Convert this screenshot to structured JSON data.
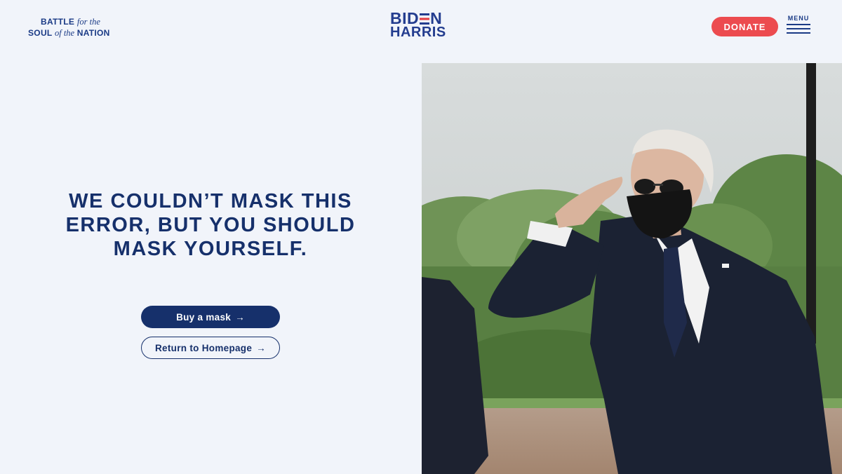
{
  "header": {
    "tagline": {
      "line1_bold": "BATTLE",
      "line1_italic": "for the",
      "line2_bold_a": "SOUL",
      "line2_italic": "of the",
      "line2_bold_b": "NATION"
    },
    "logo": {
      "line1_start": "BID",
      "line1_end": "N",
      "line2": "HARRIS"
    },
    "donate_label": "DONATE",
    "menu_label": "MENU"
  },
  "main": {
    "headline": "WE COULDN’T MASK THIS ERROR, BUT YOU SHOULD MASK YOURSELF.",
    "primary_button": {
      "label": "Buy a mask",
      "arrow": "→"
    },
    "secondary_button": {
      "label": "Return to Homepage",
      "arrow": "→"
    }
  },
  "colors": {
    "background": "#f1f4fa",
    "navy": "#16306b",
    "brand_blue": "#243d8f",
    "red": "#ec4b4f"
  },
  "icons": [
    "hamburger-menu-icon",
    "arrow-right-icon"
  ]
}
